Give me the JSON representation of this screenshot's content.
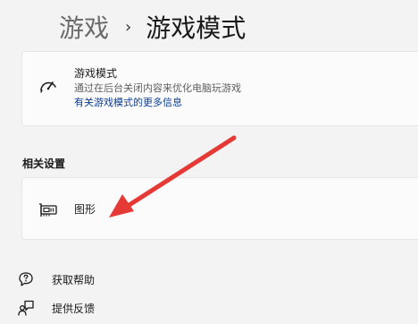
{
  "breadcrumb": {
    "parent": "游戏",
    "separator": "›",
    "current": "游戏模式"
  },
  "game_mode_card": {
    "icon": "speedometer-icon",
    "title": "游戏模式",
    "description": "通过在后台关闭内容来优化电脑玩游戏",
    "link": "有关游戏模式的更多信息"
  },
  "related": {
    "heading": "相关设置",
    "graphics": {
      "icon": "graphics-card-icon",
      "label": "图形"
    }
  },
  "footer_links": {
    "help": {
      "icon": "help-icon",
      "label": "获取帮助"
    },
    "feedback": {
      "icon": "feedback-icon",
      "label": "提供反馈"
    }
  },
  "annotation": {
    "arrow_color": "#e53935"
  }
}
